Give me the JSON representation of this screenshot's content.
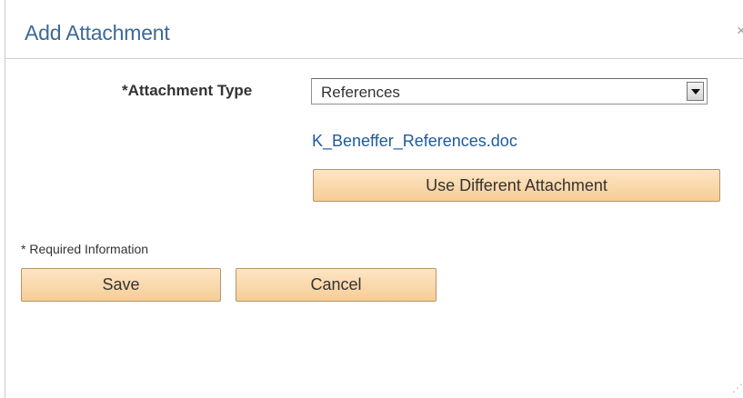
{
  "dialog": {
    "title": "Add Attachment",
    "close_glyph": "×"
  },
  "form": {
    "attachment_type_label": "*Attachment Type",
    "attachment_type_value": "References",
    "attachment_type_options": [
      "References"
    ],
    "file_name": "K_Beneffer_References.doc",
    "use_different_label": "Use Different Attachment"
  },
  "footer": {
    "required_note": "* Required Information",
    "save_label": "Save",
    "cancel_label": "Cancel"
  },
  "icons": {
    "close": "close-icon",
    "dropdown": "chevron-down-icon",
    "resize": "resize-grip-icon"
  },
  "colors": {
    "title": "#3c6a96",
    "link": "#1f5a9c",
    "button_top": "#fde5c4",
    "button_bottom": "#f6cd96",
    "button_border": "#b9936a"
  }
}
